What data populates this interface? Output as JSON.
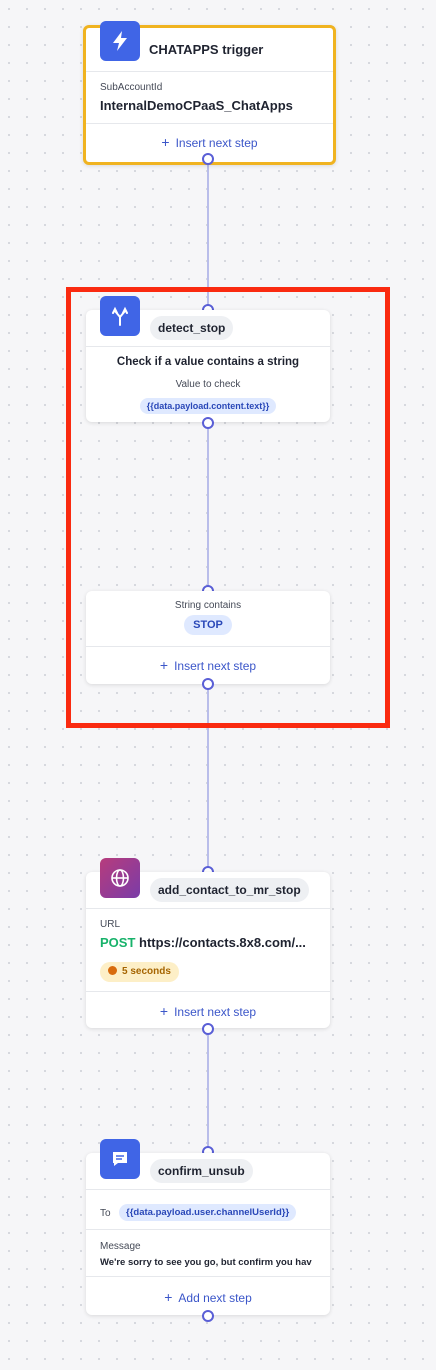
{
  "trigger": {
    "title": "CHATAPPS trigger",
    "field_label": "SubAccountId",
    "field_value": "InternalDemoCPaaS_ChatApps",
    "insert_label": "Insert next step",
    "icon": "lightning-icon"
  },
  "detect": {
    "name": "detect_stop",
    "description": "Check if a value contains a string",
    "value_label": "Value to check",
    "value": "{{data.payload.content.text}}",
    "icon": "branch-icon"
  },
  "branch": {
    "label": "String contains",
    "value": "STOP",
    "insert_label": "Insert next step"
  },
  "contact": {
    "name": "add_contact_to_mr_stop",
    "url_label": "URL",
    "method": "POST",
    "url": "https://contacts.8x8.com/...",
    "timeout": "5 seconds",
    "insert_label": "Insert next step",
    "icon": "globe-icon"
  },
  "confirm": {
    "name": "confirm_unsub",
    "to_label": "To",
    "to_value": "{{data.payload.user.channelUserId}}",
    "message_label": "Message",
    "message": "We're sorry to see you go, but confirm you hav",
    "add_label": "Add next step",
    "icon": "chat-icon"
  },
  "colors": {
    "accent": "#3b56c9",
    "trigger_border": "#f0b320",
    "highlight": "#fa2a10",
    "method": "#17b26a"
  }
}
